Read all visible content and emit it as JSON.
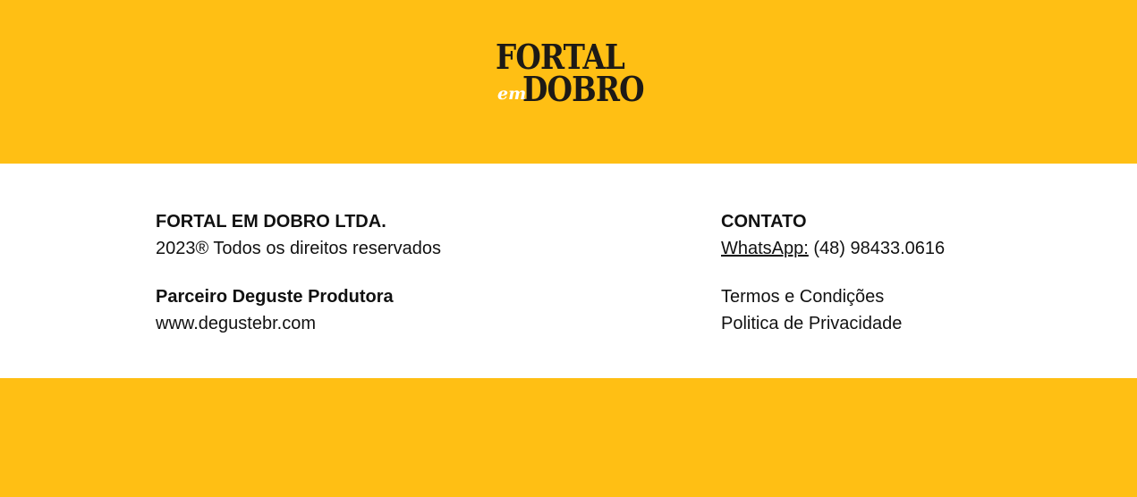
{
  "logo": {
    "line1": "FORTAL",
    "em": "em",
    "line2": "DOBRO"
  },
  "footer": {
    "company": {
      "name": "FORTAL EM DOBRO LTDA.",
      "rights": "2023® Todos os direitos reservados"
    },
    "partner": {
      "title": "Parceiro Deguste Produtora",
      "link": "www.degustebr.com"
    },
    "contact": {
      "title": "CONTATO",
      "whatsapp_label": "WhatsApp:",
      "whatsapp_number": " (48) 98433.0616"
    },
    "legal": {
      "terms": "Termos e Condições",
      "privacy": "Politica de Privacidade"
    }
  },
  "colors": {
    "brand_yellow": "#ffbf14",
    "text_dark": "#111111",
    "logo_dark": "#1d1a16"
  }
}
